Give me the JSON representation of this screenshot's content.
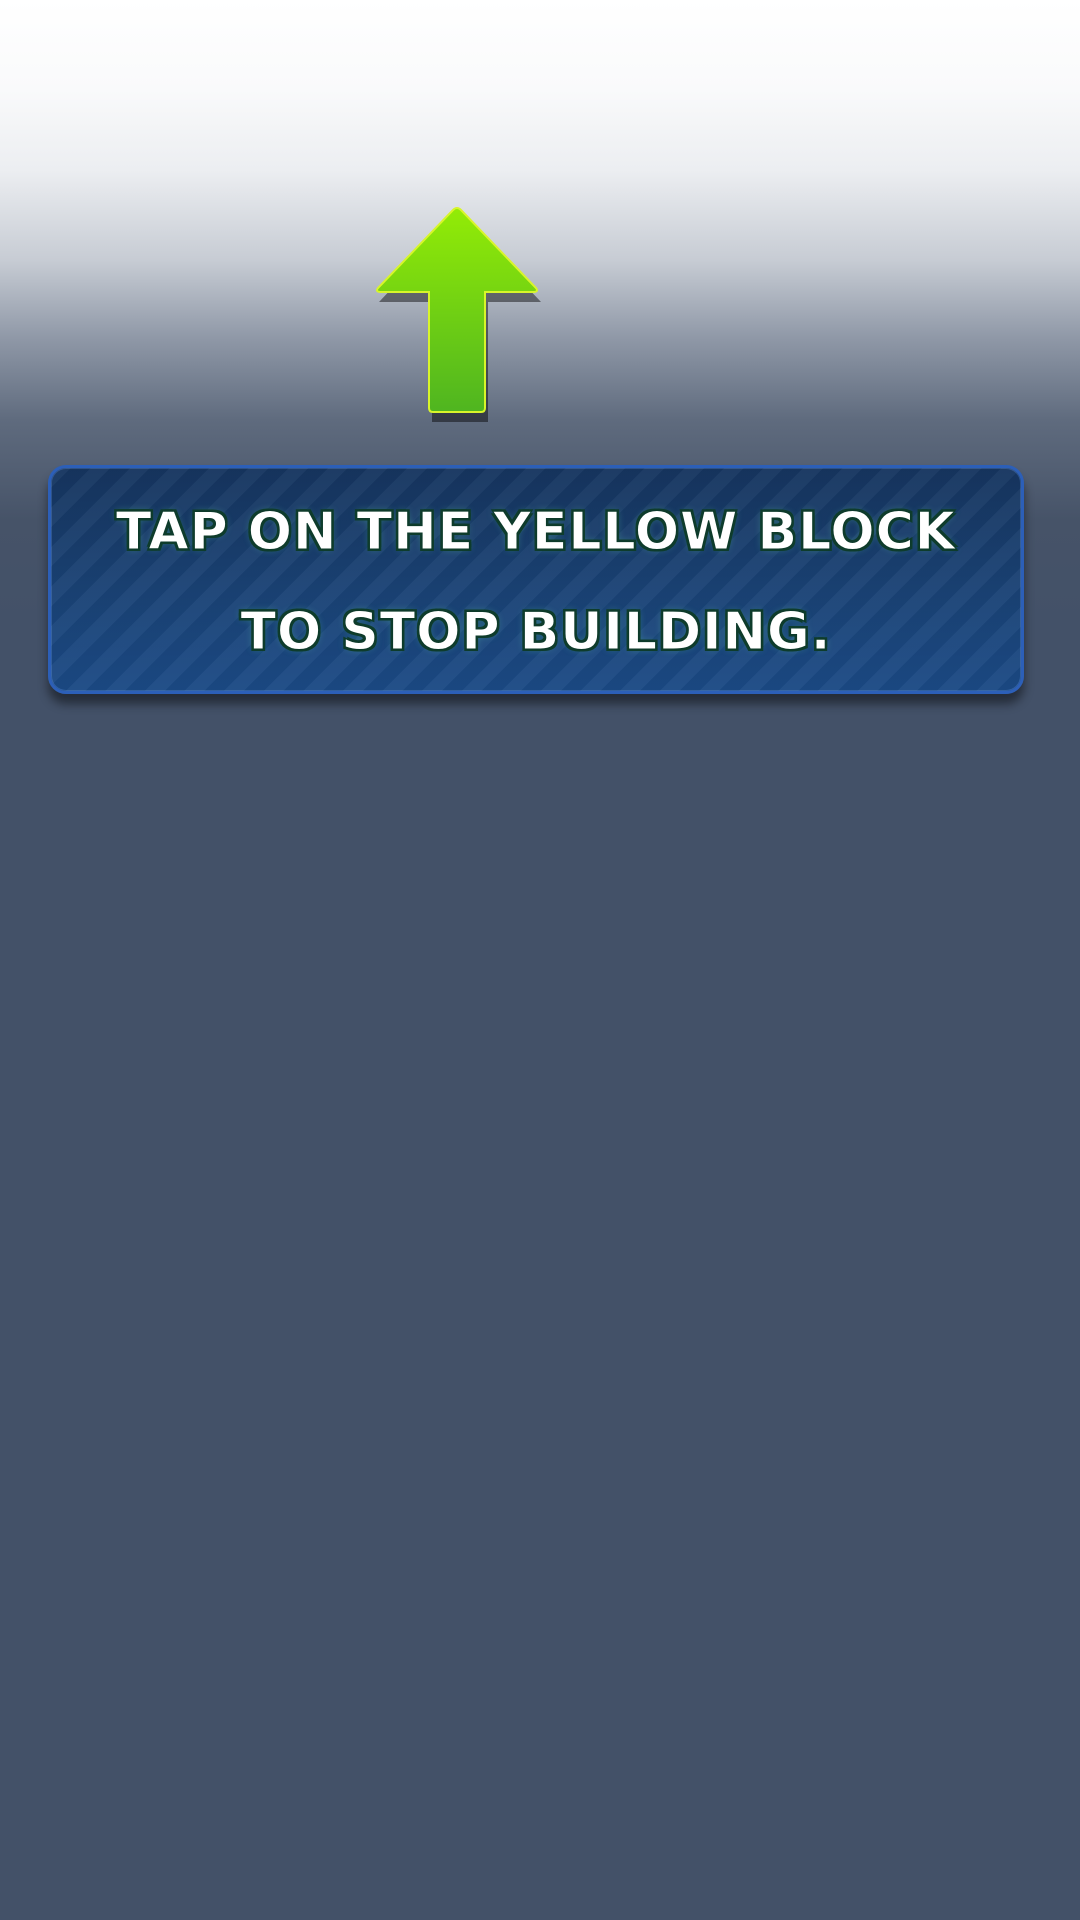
{
  "tutorial": {
    "line1": "TAP ON THE YELLOW BLOCK",
    "line2": "TO STOP BUILDING."
  },
  "icons": {
    "pointer": "up-arrow-icon"
  },
  "colors": {
    "arrow_top": "#8fe808",
    "arrow_bottom": "#52b820",
    "panel": "#1a4275",
    "panel_border": "#2c5fb8",
    "background": "#435168"
  }
}
